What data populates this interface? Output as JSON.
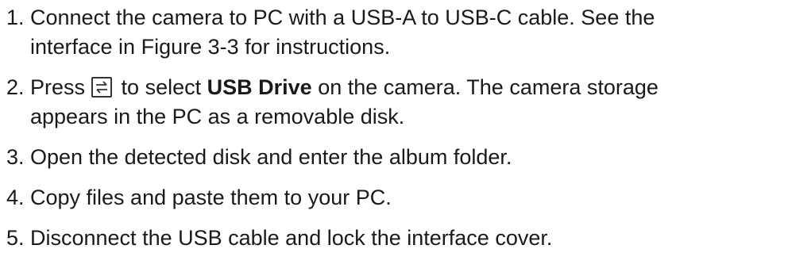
{
  "steps": [
    {
      "number": "1.",
      "line1": "Connect the camera to PC with a USB-A to USB-C cable. See the",
      "line2": "interface in Figure 3-3 for instructions."
    },
    {
      "number": "2.",
      "before_icon": "Press",
      "icon": "mode-switch-key-icon",
      "after_icon": "to select",
      "bold_term": "USB Drive",
      "after_bold": "on the camera. The camera storage",
      "line2": "appears in the PC as a removable disk."
    },
    {
      "number": "3.",
      "line1": "Open the detected disk and enter the album folder."
    },
    {
      "number": "4.",
      "line1": "Copy files and paste them to your PC."
    },
    {
      "number": "5.",
      "line1": "Disconnect the USB cable and lock the interface cover."
    }
  ]
}
